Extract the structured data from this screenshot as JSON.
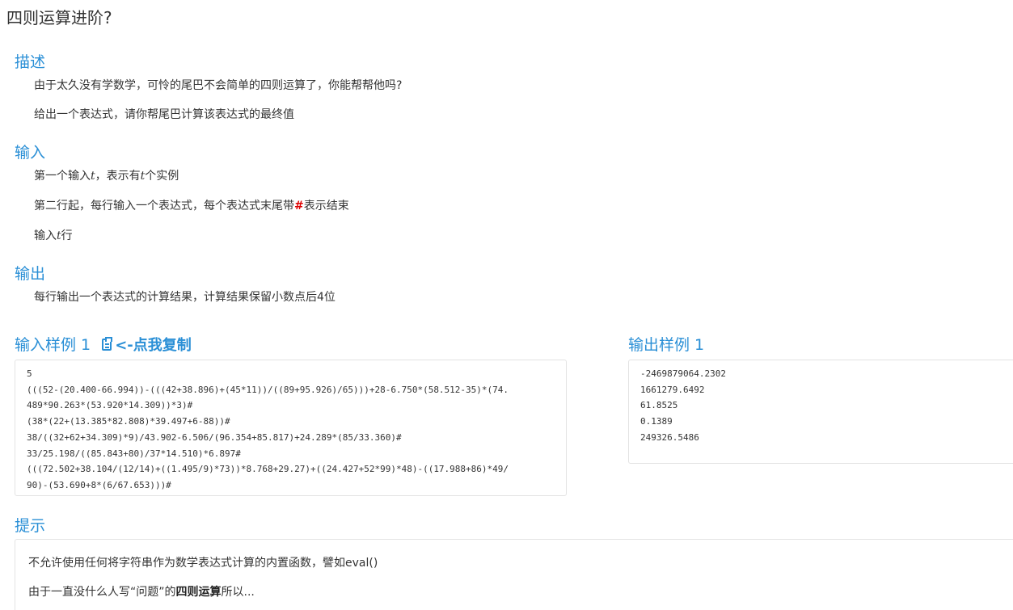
{
  "title": "四则运算进阶?",
  "sections": {
    "description": {
      "heading": "描述",
      "lines": [
        "由于太久没有学数学，可怜的尾巴不会简单的四则运算了，你能帮帮他吗?",
        "给出一个表达式，请你帮尾巴计算该表达式的最终值"
      ]
    },
    "input": {
      "heading": "输入",
      "line1": {
        "prefix": "第一个输入",
        "var1": "t",
        "mid": "，表示有",
        "var2": "t",
        "suffix": "个实例"
      },
      "line2": {
        "prefix": "第二行起，每行输入一个表达式，每个表达式末尾带",
        "hash": "#",
        "suffix": "表示结束"
      },
      "line3": {
        "prefix": "输入",
        "var": "t",
        "suffix": "行"
      }
    },
    "output": {
      "heading": "输出",
      "lines": [
        "每行输出一个表达式的计算结果，计算结果保留小数点后4位"
      ]
    }
  },
  "sample_input": {
    "heading": "输入样例 1",
    "copy_label": "<-点我复制",
    "lines": [
      "5",
      "(((52-(20.400-66.994))-(((42+38.896)+(45*11))/((89+95.926)/65)))+28-6.750*(58.512-35)*(74.",
      "489*90.263*(53.920*14.309))*3)#",
      "(38*(22+(13.385*82.808)*39.497+6-88))#",
      "38/((32+62+34.309)*9)/43.902-6.506/(96.354+85.817)+24.289*(85/33.360)#",
      "33/25.198/((85.843+80)/37*14.510)*6.897#",
      "(((72.502+38.104/(12/14)+((1.495/9)*73))*8.768+29.27)+((24.427+52*99)*48)-((17.988+86)*49/",
      "90)-(53.690+8*(6/67.653)))#"
    ]
  },
  "sample_output": {
    "heading": "输出样例 1",
    "lines": [
      "-2469879064.2302",
      "1661279.6492",
      "61.8525",
      "0.1389",
      "249326.5486"
    ]
  },
  "hint": {
    "heading": "提示",
    "line1": "不允许使用任何将字符串作为数学表达式计算的内置函数，譬如eval()",
    "line2": {
      "prefix": "由于一直没什么人写“问题”的",
      "bold": "四则运算",
      "suffix": "所以..."
    }
  },
  "colors": {
    "accent": "#2a8fd6",
    "hash": "#dd0000"
  },
  "icons": {
    "copy": "clipboard-icon"
  }
}
